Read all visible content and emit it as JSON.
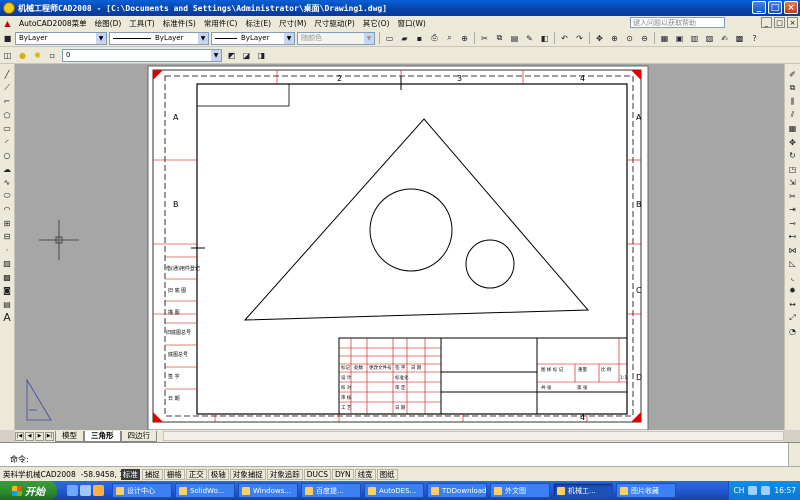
{
  "window": {
    "title": "机械工程师CAD2008 - [C:\\Documents and Settings\\Administrator\\桌面\\Drawing1.dwg]",
    "controls": [
      "_",
      "□",
      "×"
    ]
  },
  "menu": {
    "items": [
      "AutoCAD2008菜单",
      "绘图(D)",
      "工具(T)",
      "标准件(S)",
      "常用件(C)",
      "标注(E)",
      "尺寸(M)",
      "尺寸驱动(P)",
      "其它(O)",
      "窗口(W)"
    ],
    "help_placeholder": "键入问题以获取帮助",
    "mdi_controls": [
      "_",
      "□",
      "×"
    ]
  },
  "toolbar1": {
    "layer_combo": "ByLayer",
    "linetype_combo": "ByLayer",
    "lineweight_combo": "ByLayer",
    "color_combo": "随颜色"
  },
  "toolbar2": {
    "layer_value": "0"
  },
  "drawing": {
    "column_labels": [
      "2",
      "3",
      "4"
    ],
    "column_labels_bottom": [
      "4"
    ],
    "row_labels_left": [
      "A",
      "B"
    ],
    "row_labels_right": [
      "A",
      "B",
      "C",
      "D"
    ],
    "left_strip_labels": [
      "借(通)用件登记",
      "旧 底 图",
      "描 图",
      "旧底图总号",
      "底图总号",
      "签 字",
      "日 期"
    ],
    "title_block": {
      "row1": [
        "标记",
        "处数",
        "更改文件号",
        "签 字",
        "日 期"
      ],
      "row2": [
        "设 计",
        "标准化"
      ],
      "row3": [
        "校 对",
        "审 定"
      ],
      "row4": [
        "审 核"
      ],
      "row5": [
        "工 艺",
        "日 期"
      ],
      "right": [
        "图 样 标 记",
        "重量",
        "比 例",
        "共 张",
        "第 张"
      ],
      "scale_value": "1:1"
    }
  },
  "layout_tabs": {
    "nav": [
      "|◀",
      "◀",
      "▶",
      "▶|"
    ],
    "tabs": [
      "模型",
      "三角形",
      "四边行"
    ],
    "active": "三角形"
  },
  "command": {
    "prompt": "命令:"
  },
  "statusbar": {
    "app": "英科学机械CAD2008",
    "coord": "-58.9458, 1",
    "standard": "标准",
    "buttons": [
      "捕捉",
      "栅格",
      "正交",
      "极轴",
      "对象捕捉",
      "对象追踪",
      "DUCS",
      "DYN",
      "线宽",
      "图纸"
    ]
  },
  "taskbar": {
    "start": "开始",
    "tasks": [
      "设计中心",
      "SolidWo...",
      "Windows...",
      "百度提...",
      "AutoDES...",
      "TDDownload",
      "外文图",
      "机械工...",
      "图片收藏"
    ],
    "active_task": "机械工...",
    "clock": "16:57",
    "ime": "CH"
  }
}
